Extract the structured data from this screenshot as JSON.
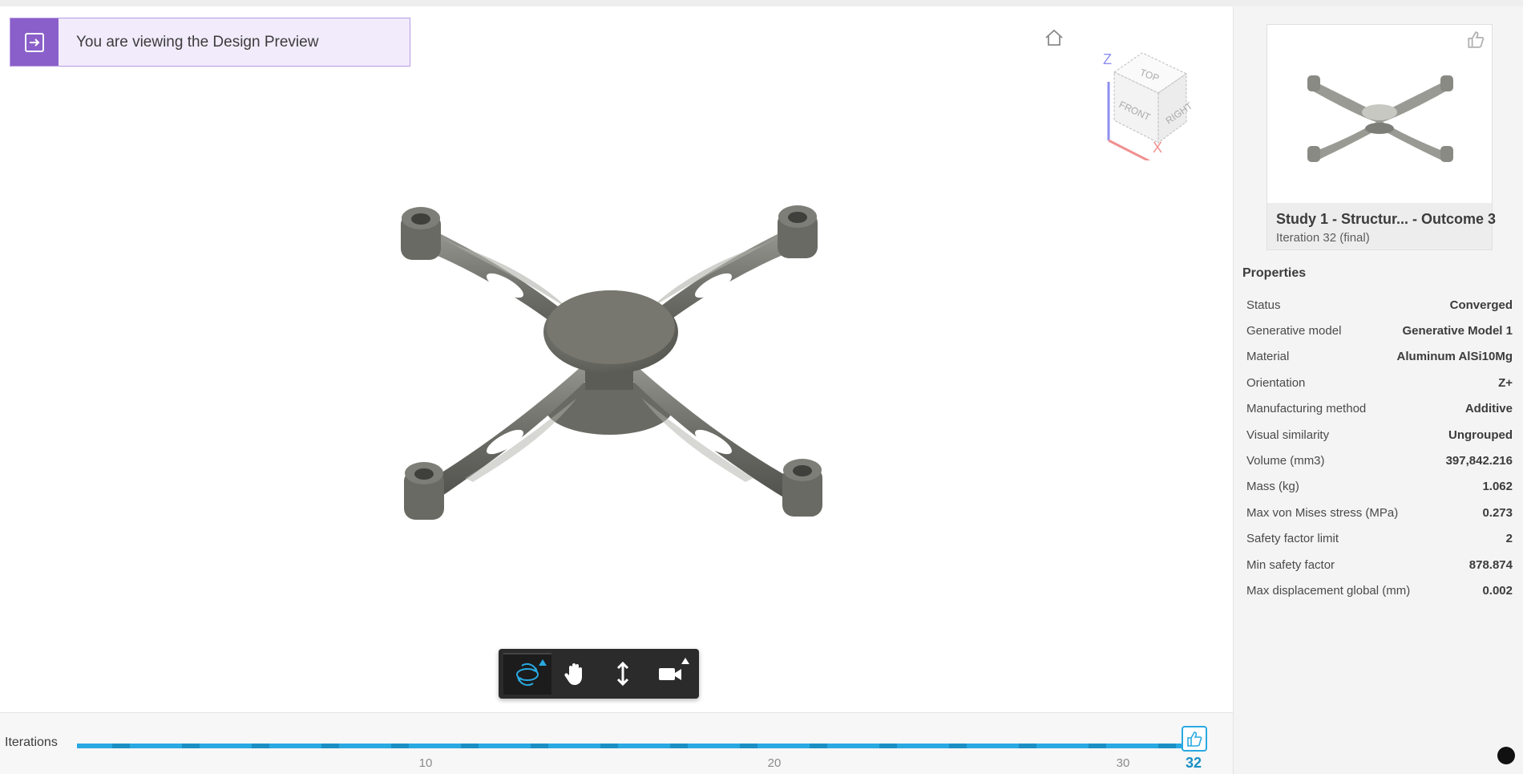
{
  "banner": {
    "text": "You are viewing the Design Preview"
  },
  "viewcube": {
    "faces": [
      "TOP",
      "FRONT",
      "RIGHT"
    ],
    "axes": [
      "Z",
      "X"
    ],
    "colors": {
      "z_axis": "#8f8ff0",
      "x_axis": "#f08f8f"
    }
  },
  "toolbar": {
    "tools": [
      "orbit-icon",
      "pan-icon",
      "zoom-icon",
      "camera-icon"
    ],
    "active_tool": "orbit"
  },
  "iterations": {
    "label": "Iterations",
    "ticks": [
      "10",
      "20",
      "30"
    ],
    "current": "32",
    "max": 32
  },
  "thumbnail": {
    "title": "Study 1 - Structur... - Outcome 3",
    "subtitle": "Iteration 32 (final)"
  },
  "properties": {
    "heading": "Properties",
    "rows": [
      {
        "key": "Status",
        "value": "Converged"
      },
      {
        "key": "Generative model",
        "value": "Generative Model 1"
      },
      {
        "key": "Material",
        "value": "Aluminum AlSi10Mg"
      },
      {
        "key": "Orientation",
        "value": "Z+"
      },
      {
        "key": "Manufacturing method",
        "value": "Additive"
      },
      {
        "key": "Visual similarity",
        "value": "Ungrouped"
      },
      {
        "key": "Volume (mm3)",
        "value": "397,842.216"
      },
      {
        "key": "Mass (kg)",
        "value": "1.062"
      },
      {
        "key": "Max von Mises stress (MPa)",
        "value": "0.273"
      },
      {
        "key": "Safety factor limit",
        "value": "2"
      },
      {
        "key": "Min safety factor",
        "value": "878.874"
      },
      {
        "key": "Max displacement global (mm)",
        "value": "0.002"
      }
    ]
  },
  "colors": {
    "accent": "#29a9e1",
    "banner_purple": "#8a5fc9",
    "model_grey": "#6f6f6a"
  }
}
